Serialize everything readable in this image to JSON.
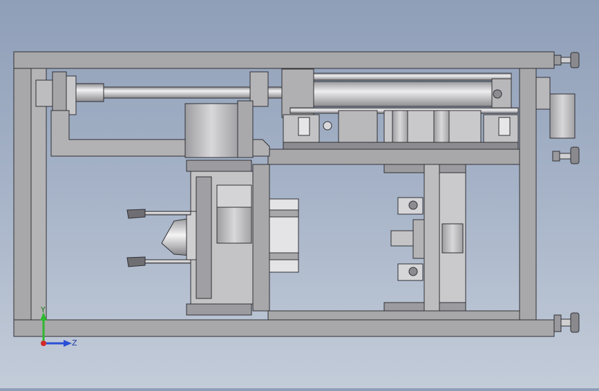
{
  "triad": {
    "y_label": "Y",
    "z_label": "Z"
  },
  "colors": {
    "frame_fill": "#a8a8aa",
    "frame_stroke": "#2f2f33",
    "part_fill": "#c9c9cb",
    "dark_part": "#6e6e72",
    "light_part": "#e2e2e4",
    "axis_y": "#2eb82e",
    "axis_z": "#2a4fd6",
    "origin": "#d22a2a"
  }
}
